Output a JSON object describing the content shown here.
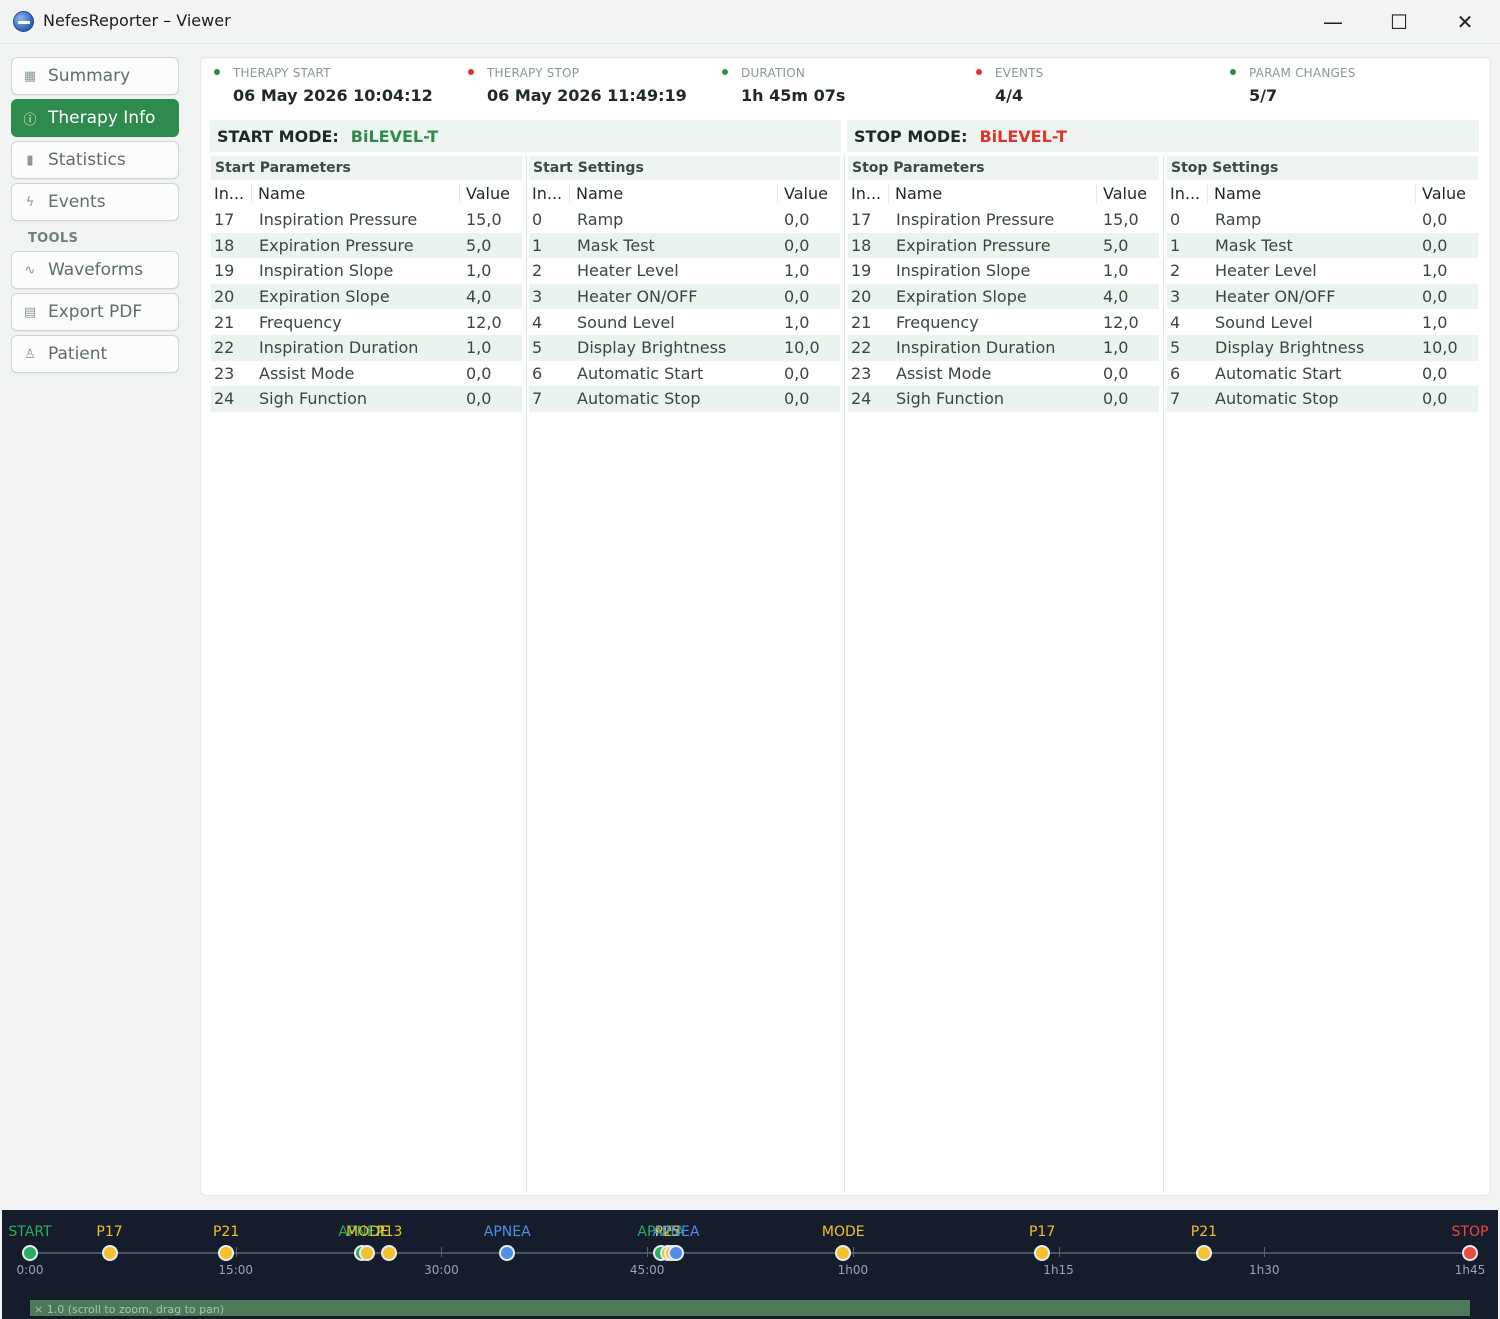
{
  "window": {
    "title": "NefesReporter – Viewer",
    "minimize": "—",
    "maximize": "☐",
    "close": "✕"
  },
  "sidebar": {
    "items": [
      {
        "label": "Summary",
        "icon": "grid-icon",
        "glyph": "▦"
      },
      {
        "label": "Therapy Info",
        "icon": "info-icon",
        "glyph": "ⓘ"
      },
      {
        "label": "Statistics",
        "icon": "bar-chart-icon",
        "glyph": "▮"
      },
      {
        "label": "Events",
        "icon": "lightning-icon",
        "glyph": "ϟ"
      }
    ],
    "tools_label": "TOOLS",
    "tools": [
      {
        "label": "Waveforms",
        "icon": "waveform-icon",
        "glyph": "∿"
      },
      {
        "label": "Export PDF",
        "icon": "document-icon",
        "glyph": "▤"
      },
      {
        "label": "Patient",
        "icon": "person-icon",
        "glyph": "♙"
      }
    ]
  },
  "stats": [
    {
      "label": "THERAPY START",
      "value": "06 May 2026  10:04:12",
      "dot_color": "#2f8a4e"
    },
    {
      "label": "THERAPY STOP",
      "value": "06 May 2026  11:49:19",
      "dot_color": "#e0352b"
    },
    {
      "label": "DURATION",
      "value": "1h 45m 07s",
      "dot_color": "#2f8a4e"
    },
    {
      "label": "EVENTS",
      "value": "4/4",
      "dot_color": "#e0352b"
    },
    {
      "label": "PARAM CHANGES",
      "value": "5/7",
      "dot_color": "#2f8a4e"
    }
  ],
  "start_mode": {
    "label": "START MODE:",
    "value": "BiLEVEL-T",
    "color": "#2f8a4e"
  },
  "stop_mode": {
    "label": "STOP MODE:",
    "value": "BiLEVEL-T",
    "color": "#e0352b"
  },
  "columns_header": {
    "index": "In...",
    "name": "Name",
    "value": "Value"
  },
  "tables": [
    {
      "title": "Start Parameters",
      "rows": [
        [
          "17",
          "Inspiration Pressure",
          "15,0"
        ],
        [
          "18",
          "Expiration Pressure",
          "5,0"
        ],
        [
          "19",
          "Inspiration Slope",
          "1,0"
        ],
        [
          "20",
          "Expiration Slope",
          "4,0"
        ],
        [
          "21",
          "Frequency",
          "12,0"
        ],
        [
          "22",
          "Inspiration Duration",
          "1,0"
        ],
        [
          "23",
          "Assist Mode",
          "0,0"
        ],
        [
          "24",
          "Sigh Function",
          "0,0"
        ]
      ]
    },
    {
      "title": "Start Settings",
      "rows": [
        [
          "0",
          "Ramp",
          "0,0"
        ],
        [
          "1",
          "Mask Test",
          "0,0"
        ],
        [
          "2",
          "Heater Level",
          "1,0"
        ],
        [
          "3",
          "Heater ON/OFF",
          "0,0"
        ],
        [
          "4",
          "Sound Level",
          "1,0"
        ],
        [
          "5",
          "Display Brightness",
          "10,0"
        ],
        [
          "6",
          "Automatic Start",
          "0,0"
        ],
        [
          "7",
          "Automatic Stop",
          "0,0"
        ]
      ]
    },
    {
      "title": "Stop Parameters",
      "rows": [
        [
          "17",
          "Inspiration Pressure",
          "15,0"
        ],
        [
          "18",
          "Expiration Pressure",
          "5,0"
        ],
        [
          "19",
          "Inspiration Slope",
          "1,0"
        ],
        [
          "20",
          "Expiration Slope",
          "4,0"
        ],
        [
          "21",
          "Frequency",
          "12,0"
        ],
        [
          "22",
          "Inspiration Duration",
          "1,0"
        ],
        [
          "23",
          "Assist Mode",
          "0,0"
        ],
        [
          "24",
          "Sigh Function",
          "0,0"
        ]
      ]
    },
    {
      "title": "Stop Settings",
      "rows": [
        [
          "0",
          "Ramp",
          "0,0"
        ],
        [
          "1",
          "Mask Test",
          "0,0"
        ],
        [
          "2",
          "Heater Level",
          "1,0"
        ],
        [
          "3",
          "Heater ON/OFF",
          "0,0"
        ],
        [
          "4",
          "Sound Level",
          "1,0"
        ],
        [
          "5",
          "Display Brightness",
          "10,0"
        ],
        [
          "6",
          "Automatic Start",
          "0,0"
        ],
        [
          "7",
          "Automatic Stop",
          "0,0"
        ]
      ]
    }
  ],
  "timeline": {
    "total_minutes": 105,
    "ticks": [
      {
        "minute": 0,
        "label": "0:00"
      },
      {
        "minute": 15,
        "label": "15:00"
      },
      {
        "minute": 30,
        "label": "30:00"
      },
      {
        "minute": 45,
        "label": "45:00"
      },
      {
        "minute": 60,
        "label": "1h00"
      },
      {
        "minute": 75,
        "label": "1h15"
      },
      {
        "minute": 90,
        "label": "1h30"
      },
      {
        "minute": 105,
        "label": "1h45"
      }
    ],
    "events": [
      {
        "minute": 0,
        "label": "START",
        "kind": "start"
      },
      {
        "minute": 5.8,
        "label": "P17",
        "kind": "param"
      },
      {
        "minute": 14.3,
        "label": "P21",
        "kind": "param"
      },
      {
        "minute": 24.2,
        "label": "APNEA",
        "kind": "apnea_start"
      },
      {
        "minute": 24.6,
        "label": "MODE",
        "kind": "mode"
      },
      {
        "minute": 26.2,
        "label": "P13",
        "kind": "param"
      },
      {
        "minute": 34.8,
        "label": "APNEA",
        "kind": "apnea"
      },
      {
        "minute": 46.0,
        "label": "APNEA",
        "kind": "apnea_start"
      },
      {
        "minute": 46.5,
        "label": "P23",
        "kind": "param"
      },
      {
        "minute": 46.8,
        "label": "P5",
        "kind": "param"
      },
      {
        "minute": 47.1,
        "label": "APNEA",
        "kind": "apnea"
      },
      {
        "minute": 59.3,
        "label": "MODE",
        "kind": "mode"
      },
      {
        "minute": 73.8,
        "label": "P17",
        "kind": "param"
      },
      {
        "minute": 85.6,
        "label": "P21",
        "kind": "param"
      },
      {
        "minute": 105,
        "label": "STOP",
        "kind": "stop"
      }
    ],
    "colors": {
      "start": "#27ae60",
      "stop": "#e74c3c",
      "param": "#f3c12c",
      "mode": "#f3c12c",
      "apnea": "#4f8fe6",
      "apnea_start": "#27ae60"
    },
    "zoom_text": "× 1.0  (scroll to zoom, drag to pan)"
  }
}
